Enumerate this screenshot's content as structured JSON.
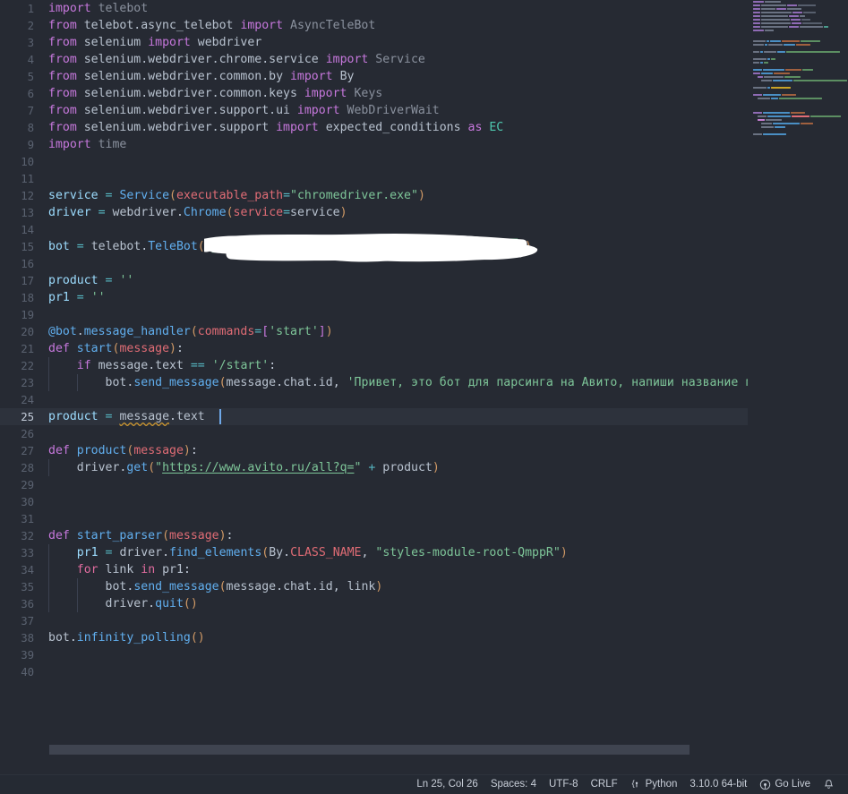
{
  "editor": {
    "language": "Python",
    "total_lines": 40,
    "active_line": 25,
    "lines": [
      {
        "n": 1,
        "text": "import telebot"
      },
      {
        "n": 2,
        "text": "from telebot.async_telebot import AsyncTeleBot"
      },
      {
        "n": 3,
        "text": "from selenium import webdriver"
      },
      {
        "n": 4,
        "text": "from selenium.webdriver.chrome.service import Service"
      },
      {
        "n": 5,
        "text": "from selenium.webdriver.common.by import By"
      },
      {
        "n": 6,
        "text": "from selenium.webdriver.common.keys import Keys"
      },
      {
        "n": 7,
        "text": "from selenium.webdriver.support.ui import WebDriverWait"
      },
      {
        "n": 8,
        "text": "from selenium.webdriver.support import expected_conditions as EC"
      },
      {
        "n": 9,
        "text": "import time"
      },
      {
        "n": 10,
        "text": ""
      },
      {
        "n": 11,
        "text": ""
      },
      {
        "n": 12,
        "text": "service = Service(executable_path=\"chromedriver.exe\")"
      },
      {
        "n": 13,
        "text": "driver = webdriver.Chrome(service=service)"
      },
      {
        "n": 14,
        "text": ""
      },
      {
        "n": 15,
        "text": "bot = telebot.TeleBot(\"\")"
      },
      {
        "n": 16,
        "text": ""
      },
      {
        "n": 17,
        "text": "product = ''"
      },
      {
        "n": 18,
        "text": "pr1 = ''"
      },
      {
        "n": 19,
        "text": ""
      },
      {
        "n": 20,
        "text": "@bot.message_handler(commands=['start'])"
      },
      {
        "n": 21,
        "text": "def start(message):"
      },
      {
        "n": 22,
        "text": "    if message.text == '/start':"
      },
      {
        "n": 23,
        "text": "        bot.send_message(message.chat.id, 'Привет, это бот для парсинга на Авито, напиши название прод"
      },
      {
        "n": 24,
        "text": ""
      },
      {
        "n": 25,
        "text": "product = message.text"
      },
      {
        "n": 26,
        "text": ""
      },
      {
        "n": 27,
        "text": "def product(message):"
      },
      {
        "n": 28,
        "text": "    driver.get(\"https://www.avito.ru/all?q=\" + product)"
      },
      {
        "n": 29,
        "text": ""
      },
      {
        "n": 30,
        "text": ""
      },
      {
        "n": 31,
        "text": ""
      },
      {
        "n": 32,
        "text": "def start_parser(message):"
      },
      {
        "n": 33,
        "text": "    pr1 = driver.find_elements(By.CLASS_NAME, \"styles-module-root-QmppR\")"
      },
      {
        "n": 34,
        "text": "    for link in pr1:"
      },
      {
        "n": 35,
        "text": "        bot.send_message(message.chat.id, link)"
      },
      {
        "n": 36,
        "text": "        driver.quit()"
      },
      {
        "n": 37,
        "text": ""
      },
      {
        "n": 38,
        "text": "bot.infinity_polling()"
      },
      {
        "n": 39,
        "text": ""
      },
      {
        "n": 40,
        "text": ""
      }
    ],
    "redaction_note": "bot token redacted with white brush scribble",
    "link_text": "https://www.avito.ru/all?q=",
    "squiggle_word": "message"
  },
  "statusbar": {
    "cursor_position": "Ln 25, Col 26",
    "indentation": "Spaces: 4",
    "encoding": "UTF-8",
    "eol": "CRLF",
    "language_mode": "Python",
    "interpreter": "3.10.0 64-bit",
    "go_live": "Go Live",
    "notifications_icon": "bell-icon",
    "python-icon": "python-brackets-icon",
    "broadcast-icon": "broadcast-icon"
  },
  "colors": {
    "editor_background": "#262a33",
    "active_line_background": "#2d323c",
    "statusbar_background": "#252a33",
    "line_number": "#5a6270",
    "active_line_number": "#c3ccd9",
    "keyword": "#c778dd",
    "string": "#7ec699",
    "function": "#61afef",
    "class": "#4ec9b0",
    "parameter": "#e06c75",
    "operator": "#56b6c2",
    "cursor": "#6fa8e8",
    "scrollbar_thumb": "#3f4450"
  }
}
